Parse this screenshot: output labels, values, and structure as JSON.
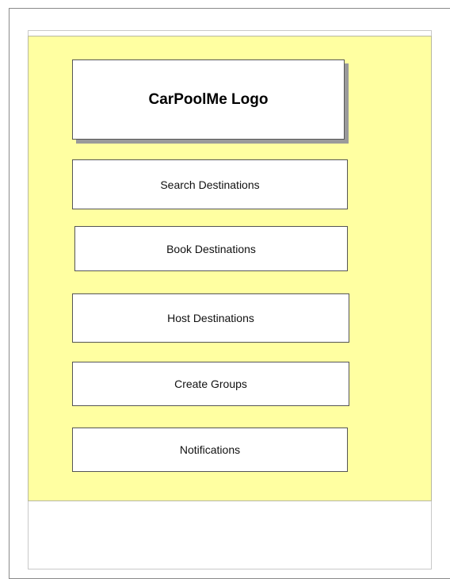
{
  "logo": {
    "text": "CarPoolMe Logo"
  },
  "menu": {
    "items": [
      {
        "label": "Search Destinations"
      },
      {
        "label": "Book Destinations"
      },
      {
        "label": "Host Destinations"
      },
      {
        "label": "Create Groups"
      },
      {
        "label": "Notifications"
      }
    ]
  },
  "colors": {
    "panel_background": "#ffffa1",
    "button_background": "#ffffff",
    "border": "#555555"
  }
}
